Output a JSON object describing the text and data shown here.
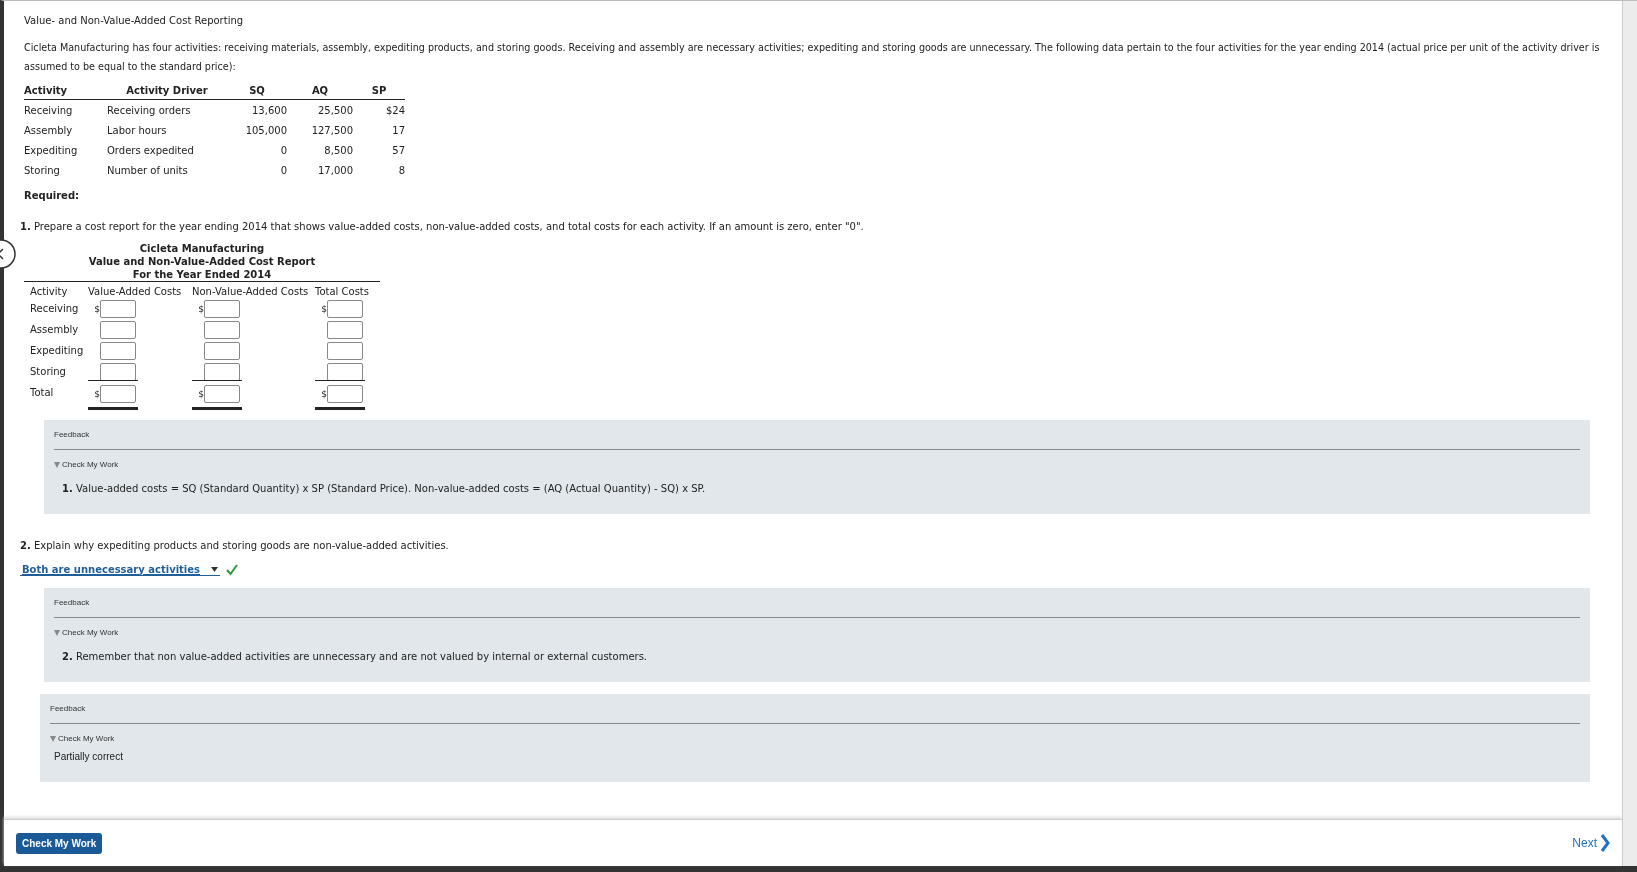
{
  "title": "Value- and Non-Value-Added Cost Reporting",
  "intro": "Cicleta Manufacturing has four activities: receiving materials, assembly, expediting products, and storing goods. Receiving and assembly are necessary activities; expediting and storing goods are unnecessary. The following data pertain to the four activities for the year ending 2014 (actual price per unit of the activity driver is assumed to be equal to the standard price):",
  "data_table": {
    "columns": [
      "Activity",
      "Activity Driver",
      "SQ",
      "AQ",
      "SP"
    ],
    "rows": [
      [
        "Receiving",
        "Receiving orders",
        "13,600",
        "25,500",
        "$24"
      ],
      [
        "Assembly",
        "Labor hours",
        "105,000",
        "127,500",
        "17"
      ],
      [
        "Expediting",
        "Orders expedited",
        "0",
        "8,500",
        "57"
      ],
      [
        "Storing",
        "Number of units",
        "0",
        "17,000",
        "8"
      ]
    ]
  },
  "required_label": "Required:",
  "part1": {
    "prompt": "**1.** Prepare a cost report for the year ending 2014 that shows value-added costs, non-value-added costs, and total costs for each activity. If an amount is zero, enter \"0\".",
    "report": {
      "company": "Cicleta Manufacturing",
      "title": "Value and Non-Value-Added Cost Report",
      "period": "For the Year Ended 2014",
      "columns": [
        "Activity",
        "Value-Added Costs",
        "Non-Value-Added Costs",
        "Total Costs"
      ],
      "rows": [
        {
          "label": "Receiving",
          "kind": "line",
          "prefix": "$"
        },
        {
          "label": "Assembly",
          "kind": "line"
        },
        {
          "label": "Expediting",
          "kind": "line"
        },
        {
          "label": "Storing",
          "kind": "line"
        },
        {
          "label": "Total",
          "kind": "total",
          "prefix": "$"
        }
      ]
    },
    "feedback": {
      "label": "Feedback",
      "toggle": "Check My Work",
      "expanded": true,
      "kind": "explanation",
      "body": "**1.** Value-added costs = SQ (Standard Quantity) x SP (Standard Price). Non-value-added costs = (AQ (Actual Quantity) - SQ) x SP."
    }
  },
  "part2": {
    "prompt": "**2.** Explain why expediting products and storing goods are non-value-added activities.",
    "select": {
      "value": "Both are unnecessary activities",
      "correct": true
    },
    "feedback": {
      "label": "Feedback",
      "toggle": "Check My Work",
      "expanded": true,
      "kind": "explanation",
      "body": "**2.** Remember that non value-added activities are unnecessary and are not valued by internal or external customers."
    }
  },
  "overall_feedback": {
    "label": "Feedback",
    "toggle": "Check My Work",
    "expanded": true,
    "kind": "status",
    "body": "Partially correct"
  },
  "footer": {
    "check_button": "Check My Work",
    "next": "Next"
  }
}
